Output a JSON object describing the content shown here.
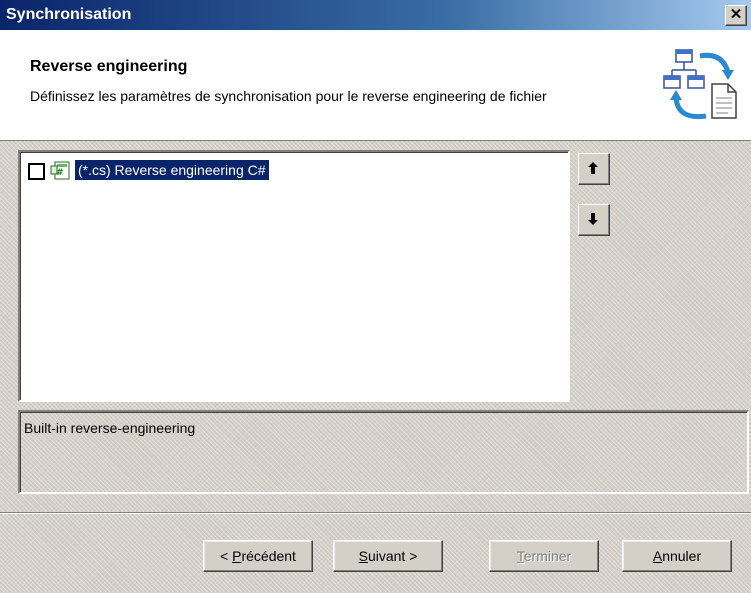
{
  "window": {
    "title": "Synchronisation",
    "close_glyph": "✕"
  },
  "header": {
    "title": "Reverse engineering",
    "description": "Définissez les paramètres de synchronisation pour le reverse engineering de fichier",
    "icon": "synchronisation-diagram-icon"
  },
  "list": {
    "items": [
      {
        "label": "(*.cs) Reverse engineering C#",
        "checked": false,
        "selected": true,
        "icon": "csharp-file-icon"
      }
    ],
    "move_up_icon": "arrow-up-icon",
    "move_down_icon": "arrow-down-icon"
  },
  "description_box": {
    "text": "Built-in reverse-engineering"
  },
  "buttons": {
    "previous": {
      "prefix": "< ",
      "mnemonic": "P",
      "rest": "récédent"
    },
    "next": {
      "mnemonic": "S",
      "rest": "uivant >"
    },
    "finish": {
      "mnemonic": "T",
      "rest": "erminer",
      "enabled": false
    },
    "cancel": {
      "mnemonic": "A",
      "rest": "nnuler"
    }
  },
  "colors": {
    "selection": "#0a246a",
    "titlebar": "#0a246a",
    "face": "#d4d0c8"
  }
}
